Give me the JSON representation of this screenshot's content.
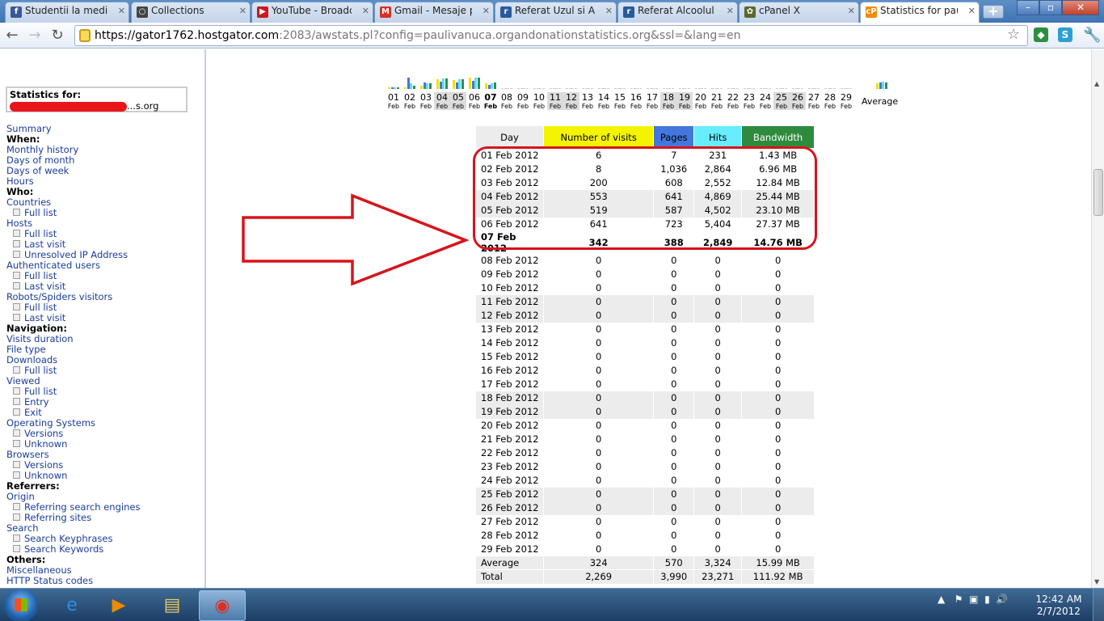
{
  "browser": {
    "tabs": [
      {
        "label": "Studentii la medicir",
        "icon": "facebook-icon",
        "color": "#3b5998",
        "glyph": "f"
      },
      {
        "label": "Collections",
        "icon": "collections-icon",
        "color": "#444444",
        "glyph": "○"
      },
      {
        "label": "YouTube - Broadca",
        "icon": "youtube-icon",
        "color": "#cc181e",
        "glyph": "▶"
      },
      {
        "label": "Gmail - Mesaje prin",
        "icon": "gmail-icon",
        "color": "#d93025",
        "glyph": "M"
      },
      {
        "label": "Referat Uzul si Abuz",
        "icon": "referat-icon",
        "color": "#2a5a9c",
        "glyph": "r"
      },
      {
        "label": "Referat Alcoolul si E",
        "icon": "referat-icon",
        "color": "#2a5a9c",
        "glyph": "r"
      },
      {
        "label": "cPanel X",
        "icon": "cpanel-icon",
        "color": "#5a6a2a",
        "glyph": "✿"
      },
      {
        "label": "Statistics for pauliv",
        "icon": "cpanel-cp-icon",
        "color": "#f08a00",
        "glyph": "cP"
      }
    ],
    "url_host": "https://gator1762.hostgator.com",
    "url_rest": ":2083/awstats.pl?config=paulivanuca.organdonationstatistics.org&ssl=&lang=en"
  },
  "sidebar": {
    "stats_for_label": "Statistics for:",
    "stats_for_domain_suffix": "...s.org",
    "menu": [
      {
        "type": "link",
        "text": "Summary"
      },
      {
        "type": "head",
        "text": "When:"
      },
      {
        "type": "link",
        "text": "Monthly history"
      },
      {
        "type": "link",
        "text": "Days of month"
      },
      {
        "type": "link",
        "text": "Days of week"
      },
      {
        "type": "link",
        "text": "Hours"
      },
      {
        "type": "head",
        "text": "Who:"
      },
      {
        "type": "link",
        "text": "Countries"
      },
      {
        "type": "sub",
        "text": "Full list"
      },
      {
        "type": "link",
        "text": "Hosts"
      },
      {
        "type": "sub",
        "text": "Full list"
      },
      {
        "type": "sub",
        "text": "Last visit"
      },
      {
        "type": "sub",
        "text": "Unresolved IP Address"
      },
      {
        "type": "link",
        "text": "Authenticated users"
      },
      {
        "type": "sub",
        "text": "Full list"
      },
      {
        "type": "sub",
        "text": "Last visit"
      },
      {
        "type": "link",
        "text": "Robots/Spiders visitors"
      },
      {
        "type": "sub",
        "text": "Full list"
      },
      {
        "type": "sub",
        "text": "Last visit"
      },
      {
        "type": "head",
        "text": "Navigation:"
      },
      {
        "type": "link",
        "text": "Visits duration"
      },
      {
        "type": "link",
        "text": "File type"
      },
      {
        "type": "link",
        "text": "Downloads"
      },
      {
        "type": "sub",
        "text": "Full list"
      },
      {
        "type": "link",
        "text": "Viewed"
      },
      {
        "type": "sub",
        "text": "Full list"
      },
      {
        "type": "sub",
        "text": "Entry"
      },
      {
        "type": "sub",
        "text": "Exit"
      },
      {
        "type": "link",
        "text": "Operating Systems"
      },
      {
        "type": "sub",
        "text": "Versions"
      },
      {
        "type": "sub",
        "text": "Unknown"
      },
      {
        "type": "link",
        "text": "Browsers"
      },
      {
        "type": "sub",
        "text": "Versions"
      },
      {
        "type": "sub",
        "text": "Unknown"
      },
      {
        "type": "head",
        "text": "Referrers:"
      },
      {
        "type": "link",
        "text": "Origin"
      },
      {
        "type": "sub",
        "text": "Referring search engines"
      },
      {
        "type": "sub",
        "text": "Referring sites"
      },
      {
        "type": "link",
        "text": "Search"
      },
      {
        "type": "sub",
        "text": "Search Keyphrases"
      },
      {
        "type": "sub",
        "text": "Search Keywords"
      },
      {
        "type": "head",
        "text": "Others:"
      },
      {
        "type": "link",
        "text": "Miscellaneous"
      },
      {
        "type": "link",
        "text": "HTTP Status codes"
      }
    ]
  },
  "chart": {
    "days": [
      "01",
      "02",
      "03",
      "04",
      "05",
      "06",
      "07",
      "08",
      "09",
      "10",
      "11",
      "12",
      "13",
      "14",
      "15",
      "16",
      "17",
      "18",
      "19",
      "20",
      "21",
      "22",
      "23",
      "24",
      "25",
      "26",
      "27",
      "28",
      "29"
    ],
    "month_label": "Feb",
    "weekend_days": [
      "04",
      "05",
      "11",
      "12",
      "18",
      "19",
      "25",
      "26"
    ],
    "today": "07",
    "average_label": "Average",
    "series_colors": {
      "visits": "#f4e200",
      "pages": "#4477dd",
      "hits": "#66ddee",
      "bandwidth": "#2e8b57"
    }
  },
  "table": {
    "headers": {
      "day": "Day",
      "visits": "Number of visits",
      "pages": "Pages",
      "hits": "Hits",
      "bandwidth": "Bandwidth"
    },
    "header_colors": {
      "day": "#ececec",
      "visits": "#f4f400",
      "pages": "#4477dd",
      "hits": "#66eeff",
      "bandwidth": "#2e8b3e"
    },
    "rows": [
      {
        "day": "01 Feb 2012",
        "visits": "6",
        "pages": "7",
        "hits": "231",
        "bandwidth": "1.43 MB"
      },
      {
        "day": "02 Feb 2012",
        "visits": "8",
        "pages": "1,036",
        "hits": "2,864",
        "bandwidth": "6.96 MB"
      },
      {
        "day": "03 Feb 2012",
        "visits": "200",
        "pages": "608",
        "hits": "2,552",
        "bandwidth": "12.84 MB"
      },
      {
        "day": "04 Feb 2012",
        "visits": "553",
        "pages": "641",
        "hits": "4,869",
        "bandwidth": "25.44 MB",
        "weekend": true
      },
      {
        "day": "05 Feb 2012",
        "visits": "519",
        "pages": "587",
        "hits": "4,502",
        "bandwidth": "23.10 MB",
        "weekend": true
      },
      {
        "day": "06 Feb 2012",
        "visits": "641",
        "pages": "723",
        "hits": "5,404",
        "bandwidth": "27.37 MB"
      },
      {
        "day": "07 Feb 2012",
        "visits": "342",
        "pages": "388",
        "hits": "2,849",
        "bandwidth": "14.76 MB",
        "today": true
      },
      {
        "day": "08 Feb 2012",
        "visits": "0",
        "pages": "0",
        "hits": "0",
        "bandwidth": "0"
      },
      {
        "day": "09 Feb 2012",
        "visits": "0",
        "pages": "0",
        "hits": "0",
        "bandwidth": "0"
      },
      {
        "day": "10 Feb 2012",
        "visits": "0",
        "pages": "0",
        "hits": "0",
        "bandwidth": "0"
      },
      {
        "day": "11 Feb 2012",
        "visits": "0",
        "pages": "0",
        "hits": "0",
        "bandwidth": "0",
        "weekend": true
      },
      {
        "day": "12 Feb 2012",
        "visits": "0",
        "pages": "0",
        "hits": "0",
        "bandwidth": "0",
        "weekend": true
      },
      {
        "day": "13 Feb 2012",
        "visits": "0",
        "pages": "0",
        "hits": "0",
        "bandwidth": "0"
      },
      {
        "day": "14 Feb 2012",
        "visits": "0",
        "pages": "0",
        "hits": "0",
        "bandwidth": "0"
      },
      {
        "day": "15 Feb 2012",
        "visits": "0",
        "pages": "0",
        "hits": "0",
        "bandwidth": "0"
      },
      {
        "day": "16 Feb 2012",
        "visits": "0",
        "pages": "0",
        "hits": "0",
        "bandwidth": "0"
      },
      {
        "day": "17 Feb 2012",
        "visits": "0",
        "pages": "0",
        "hits": "0",
        "bandwidth": "0"
      },
      {
        "day": "18 Feb 2012",
        "visits": "0",
        "pages": "0",
        "hits": "0",
        "bandwidth": "0",
        "weekend": true
      },
      {
        "day": "19 Feb 2012",
        "visits": "0",
        "pages": "0",
        "hits": "0",
        "bandwidth": "0",
        "weekend": true
      },
      {
        "day": "20 Feb 2012",
        "visits": "0",
        "pages": "0",
        "hits": "0",
        "bandwidth": "0"
      },
      {
        "day": "21 Feb 2012",
        "visits": "0",
        "pages": "0",
        "hits": "0",
        "bandwidth": "0"
      },
      {
        "day": "22 Feb 2012",
        "visits": "0",
        "pages": "0",
        "hits": "0",
        "bandwidth": "0"
      },
      {
        "day": "23 Feb 2012",
        "visits": "0",
        "pages": "0",
        "hits": "0",
        "bandwidth": "0"
      },
      {
        "day": "24 Feb 2012",
        "visits": "0",
        "pages": "0",
        "hits": "0",
        "bandwidth": "0"
      },
      {
        "day": "25 Feb 2012",
        "visits": "0",
        "pages": "0",
        "hits": "0",
        "bandwidth": "0",
        "weekend": true
      },
      {
        "day": "26 Feb 2012",
        "visits": "0",
        "pages": "0",
        "hits": "0",
        "bandwidth": "0",
        "weekend": true
      },
      {
        "day": "27 Feb 2012",
        "visits": "0",
        "pages": "0",
        "hits": "0",
        "bandwidth": "0"
      },
      {
        "day": "28 Feb 2012",
        "visits": "0",
        "pages": "0",
        "hits": "0",
        "bandwidth": "0"
      },
      {
        "day": "29 Feb 2012",
        "visits": "0",
        "pages": "0",
        "hits": "0",
        "bandwidth": "0"
      }
    ],
    "average": {
      "day": "Average",
      "visits": "324",
      "pages": "570",
      "hits": "3,324",
      "bandwidth": "15.99 MB"
    },
    "total": {
      "day": "Total",
      "visits": "2,269",
      "pages": "3,990",
      "hits": "23,271",
      "bandwidth": "111.92 MB"
    }
  },
  "annotation": {
    "color": "#d7141b"
  },
  "taskbar": {
    "time": "12:42 AM",
    "date": "2/7/2012",
    "apps": [
      {
        "name": "ie-icon",
        "glyph": "e",
        "color": "#2d8fe0"
      },
      {
        "name": "media-player-icon",
        "glyph": "▶",
        "color": "#f08a00"
      },
      {
        "name": "explorer-folder-icon",
        "glyph": "▤",
        "color": "#e8c860"
      },
      {
        "name": "chrome-icon",
        "glyph": "◉",
        "color": "#d93025",
        "active": true
      }
    ]
  }
}
